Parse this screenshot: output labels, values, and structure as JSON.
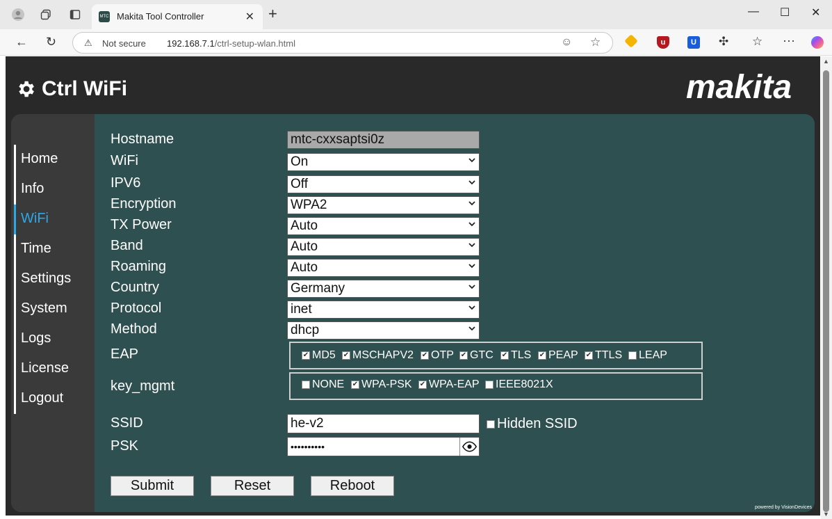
{
  "browser": {
    "tab_title": "Makita Tool Controller",
    "favicon_text": "MTC",
    "security_label": "Not secure",
    "url_host": "192.168.7.1",
    "url_path": "/ctrl-setup-wlan.html"
  },
  "page": {
    "title": "Ctrl WiFi",
    "logo_text": "makita",
    "footer": "powered by VisionDevices"
  },
  "sidebar": {
    "items": [
      {
        "label": "Home"
      },
      {
        "label": "Info"
      },
      {
        "label": "WiFi",
        "active": true
      },
      {
        "label": "Time"
      },
      {
        "label": "Settings"
      },
      {
        "label": "System"
      },
      {
        "label": "Logs"
      },
      {
        "label": "License"
      },
      {
        "label": "Logout"
      }
    ]
  },
  "form": {
    "hostname": {
      "label": "Hostname",
      "value": "mtc-cxxsaptsi0z"
    },
    "wifi": {
      "label": "WiFi",
      "value": "On"
    },
    "ipv6": {
      "label": "IPV6",
      "value": "Off"
    },
    "encryption": {
      "label": "Encryption",
      "value": "WPA2"
    },
    "tx_power": {
      "label": "TX Power",
      "value": "Auto"
    },
    "band": {
      "label": "Band",
      "value": "Auto"
    },
    "roaming": {
      "label": "Roaming",
      "value": "Auto"
    },
    "country": {
      "label": "Country",
      "value": "Germany"
    },
    "protocol": {
      "label": "Protocol",
      "value": "inet"
    },
    "method": {
      "label": "Method",
      "value": "dhcp"
    },
    "eap": {
      "label": "EAP",
      "options": [
        {
          "label": "MD5",
          "checked": true
        },
        {
          "label": "MSCHAPV2",
          "checked": true
        },
        {
          "label": "OTP",
          "checked": true
        },
        {
          "label": "GTC",
          "checked": true
        },
        {
          "label": "TLS",
          "checked": true
        },
        {
          "label": "PEAP",
          "checked": true
        },
        {
          "label": "TTLS",
          "checked": true
        },
        {
          "label": "LEAP",
          "checked": false
        }
      ]
    },
    "key_mgmt": {
      "label": "key_mgmt",
      "options": [
        {
          "label": "NONE",
          "checked": false
        },
        {
          "label": "WPA-PSK",
          "checked": true
        },
        {
          "label": "WPA-EAP",
          "checked": true
        },
        {
          "label": "IEEE8021X",
          "checked": false
        }
      ]
    },
    "ssid": {
      "label": "SSID",
      "value": "he-v2",
      "hidden_label": "Hidden SSID",
      "hidden_checked": false
    },
    "psk": {
      "label": "PSK",
      "value": "••••••••••"
    }
  },
  "buttons": {
    "submit": "Submit",
    "reset": "Reset",
    "reboot": "Reboot"
  }
}
